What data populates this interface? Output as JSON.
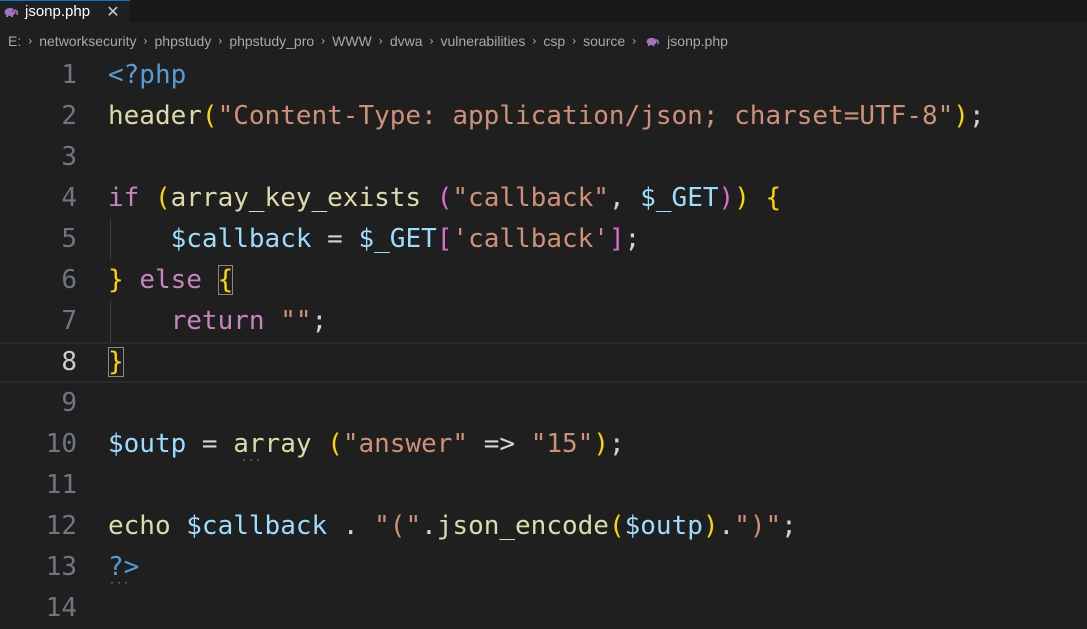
{
  "tab": {
    "filename": "jsonp.php",
    "close_label": "✕",
    "icon": "php-elephant-icon",
    "icon_color": "#a074c4"
  },
  "breadcrumb": {
    "items": [
      "E:",
      "networksecurity",
      "phpstudy",
      "phpstudy_pro",
      "WWW",
      "dvwa",
      "vulnerabilities",
      "csp",
      "source",
      "jsonp.php"
    ],
    "separator": "›"
  },
  "editor": {
    "current_line": 8,
    "line_numbers": [
      "1",
      "2",
      "3",
      "4",
      "5",
      "6",
      "7",
      "8",
      "9",
      "10",
      "11",
      "12",
      "13",
      "14"
    ],
    "lines": [
      [
        {
          "t": "<?php",
          "c": "tag"
        }
      ],
      [
        {
          "t": "header",
          "c": "fn"
        },
        {
          "t": "(",
          "c": "b1"
        },
        {
          "t": "\"Content-Type: application/json; charset=UTF-8\"",
          "c": "str"
        },
        {
          "t": ")",
          "c": "b1"
        },
        {
          "t": ";",
          "c": "op"
        }
      ],
      [],
      [
        {
          "t": "if",
          "c": "kw"
        },
        {
          "t": " ",
          "c": "op"
        },
        {
          "t": "(",
          "c": "b1"
        },
        {
          "t": "array_key_exists",
          "c": "fn"
        },
        {
          "t": " ",
          "c": "op"
        },
        {
          "t": "(",
          "c": "b2"
        },
        {
          "t": "\"callback\"",
          "c": "str"
        },
        {
          "t": ", ",
          "c": "op"
        },
        {
          "t": "$_GET",
          "c": "var"
        },
        {
          "t": ")",
          "c": "b2"
        },
        {
          "t": ")",
          "c": "b1"
        },
        {
          "t": " ",
          "c": "op"
        },
        {
          "t": "{",
          "c": "b1"
        }
      ],
      [
        {
          "t": "    ",
          "c": "op"
        },
        {
          "t": "$callback",
          "c": "var"
        },
        {
          "t": " = ",
          "c": "op"
        },
        {
          "t": "$_GET",
          "c": "var"
        },
        {
          "t": "[",
          "c": "b2"
        },
        {
          "t": "'callback'",
          "c": "str"
        },
        {
          "t": "]",
          "c": "b2"
        },
        {
          "t": ";",
          "c": "op"
        }
      ],
      [
        {
          "t": "}",
          "c": "b1"
        },
        {
          "t": " ",
          "c": "op"
        },
        {
          "t": "else",
          "c": "kw"
        },
        {
          "t": " ",
          "c": "op"
        },
        {
          "t": "{",
          "c": "b1",
          "m": true
        }
      ],
      [
        {
          "t": "    ",
          "c": "op"
        },
        {
          "t": "return",
          "c": "kw"
        },
        {
          "t": " ",
          "c": "op"
        },
        {
          "t": "\"\"",
          "c": "str"
        },
        {
          "t": ";",
          "c": "op"
        }
      ],
      [
        {
          "t": "}",
          "c": "b1",
          "m": true
        }
      ],
      [],
      [
        {
          "t": "$outp",
          "c": "var"
        },
        {
          "t": " = ",
          "c": "op"
        },
        {
          "t": "array",
          "c": "fn"
        },
        {
          "t": " ",
          "c": "op"
        },
        {
          "t": "(",
          "c": "b1"
        },
        {
          "t": "\"answer\"",
          "c": "str"
        },
        {
          "t": " => ",
          "c": "op"
        },
        {
          "t": "\"15\"",
          "c": "str"
        },
        {
          "t": ")",
          "c": "b1"
        },
        {
          "t": ";",
          "c": "op"
        }
      ],
      [],
      [
        {
          "t": "echo",
          "c": "fn"
        },
        {
          "t": " ",
          "c": "op"
        },
        {
          "t": "$callback",
          "c": "var"
        },
        {
          "t": " . ",
          "c": "op"
        },
        {
          "t": "\"(\"",
          "c": "str"
        },
        {
          "t": ".",
          "c": "op"
        },
        {
          "t": "json_encode",
          "c": "fn"
        },
        {
          "t": "(",
          "c": "b1"
        },
        {
          "t": "$outp",
          "c": "var"
        },
        {
          "t": ")",
          "c": "b1"
        },
        {
          "t": ".",
          "c": "op"
        },
        {
          "t": "\")\"",
          "c": "str"
        },
        {
          "t": ";",
          "c": "op"
        }
      ],
      [
        {
          "t": "?>",
          "c": "tag"
        }
      ],
      []
    ]
  },
  "colors": {
    "background": "#1f1f1f",
    "tag": "#569cd6",
    "function": "#dcdcaa",
    "string": "#ce9178",
    "keyword": "#c586c0",
    "variable": "#9cdcfe",
    "bracket_level1": "#ffd700",
    "bracket_level2": "#da70d6"
  }
}
